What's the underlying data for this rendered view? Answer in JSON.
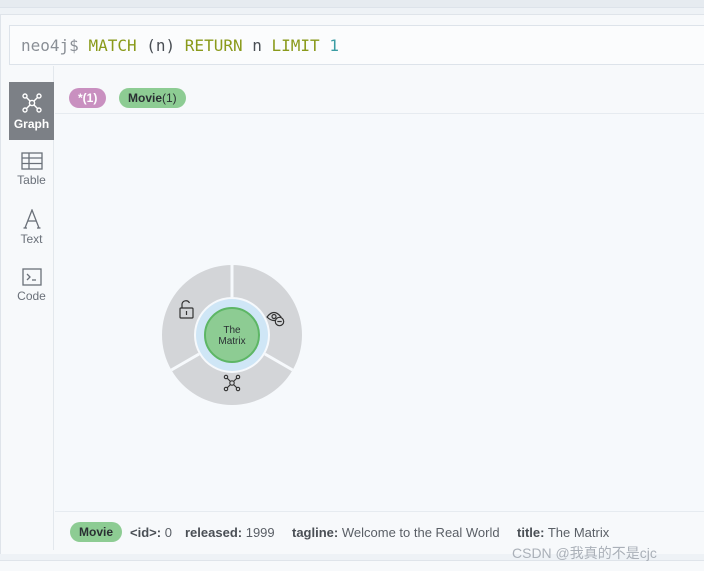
{
  "editor": {
    "prompt": "neo4j$",
    "query_match": "MATCH",
    "query_pattern": "(n)",
    "query_return": "RETURN",
    "query_var": "n",
    "query_limit": "LIMIT",
    "query_limit_value": "1"
  },
  "sidebar": {
    "items": [
      {
        "label": "Graph",
        "icon": "graph-icon",
        "active": true
      },
      {
        "label": "Table",
        "icon": "table-icon",
        "active": false
      },
      {
        "label": "Text",
        "icon": "text-icon",
        "active": false
      },
      {
        "label": "Code",
        "icon": "code-icon",
        "active": false
      }
    ]
  },
  "labels_bar": {
    "all_nodes": "*(1)",
    "movie_label": "Movie",
    "movie_count": "(1)"
  },
  "graph": {
    "node_caption_line1": "The",
    "node_caption_line2": "Matrix",
    "node_color": "#8dcc93",
    "ring_icons": [
      "unlock-icon",
      "hide-eye-icon",
      "expand-graph-icon"
    ]
  },
  "properties": {
    "label": "Movie",
    "id_key": "<id>:",
    "id_value": "0",
    "released_key": "released:",
    "released_value": "1999",
    "tagline_key": "tagline:",
    "tagline_value": "Welcome to the Real World",
    "title_key": "title:",
    "title_value": "The Matrix"
  },
  "watermark": "CSDN @我真的不是cjc"
}
